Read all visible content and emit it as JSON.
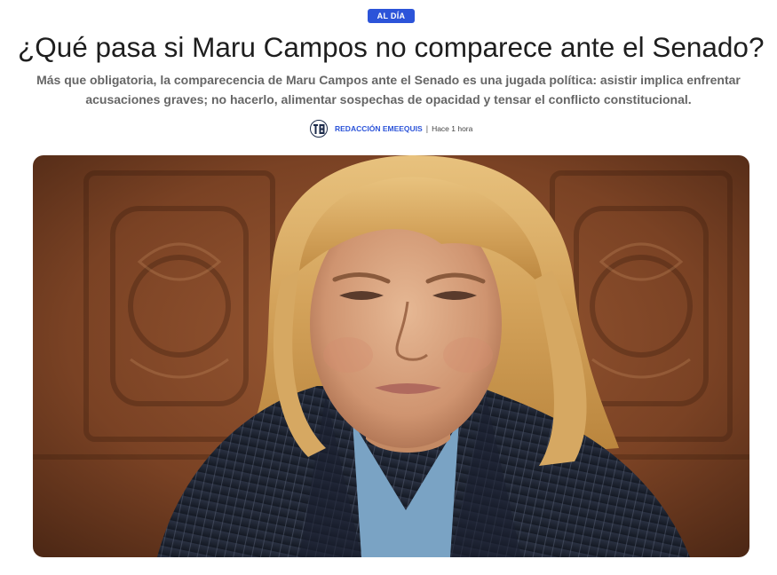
{
  "article": {
    "section_badge": "AL DÍA",
    "headline": "¿Qué pasa si Maru Campos no comparece ante el Senado?",
    "dek": "Más que obligatoria, la comparecencia de Maru Campos ante el Senado es una jugada política: asistir implica enfrentar acusaciones graves; no hacerlo, alimentar sospechas de opacidad y tensar el conflicto constitucional.",
    "byline": {
      "author": "REDACCIÓN EMEEQUIS",
      "separator": "|",
      "time": "Hace 1 hora"
    }
  },
  "icons": {
    "author_avatar": "emeequis-logo-icon"
  },
  "colors": {
    "accent": "#2c54d9",
    "headline": "#1e1e1e",
    "dek": "#666666"
  }
}
